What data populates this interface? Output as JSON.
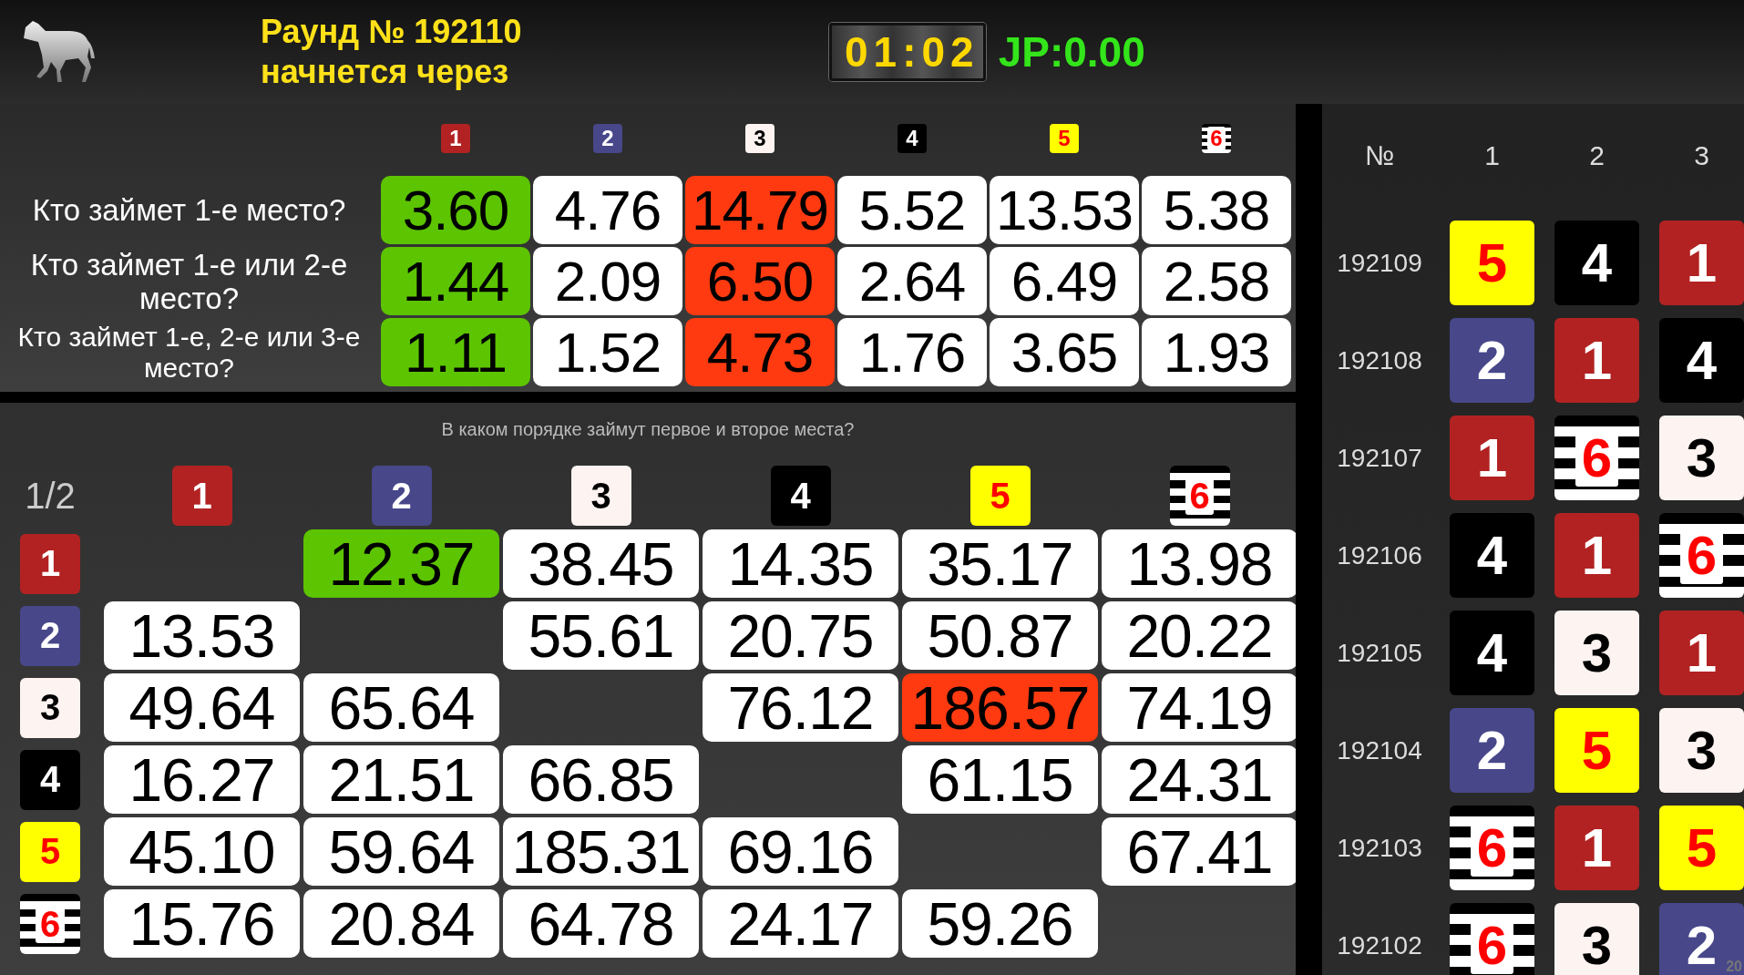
{
  "header": {
    "title_line_1": "Раунд № 192110",
    "title_line_2": "начнется через",
    "timer": "01:02",
    "jackpot": "JP:0.00"
  },
  "win_odds": {
    "columns": [
      {
        "label": "1",
        "color": "#b22222",
        "kind": "solid"
      },
      {
        "label": "2",
        "color": "#47478a",
        "kind": "solid"
      },
      {
        "label": "3",
        "color": "#fdf3f0",
        "kind": "solid"
      },
      {
        "label": "4",
        "color": "#000000",
        "kind": "solid"
      },
      {
        "label": "5",
        "color": "#ffff00",
        "kind": "solid"
      },
      {
        "label": "6",
        "kind": "striped"
      }
    ],
    "rows": [
      {
        "question": "Кто займет 1-е место?",
        "cells": [
          {
            "value": "3.60",
            "color": "#5cc400"
          },
          {
            "value": "4.76",
            "color": "#ffffff"
          },
          {
            "value": "14.79",
            "color": "#ff3a10"
          },
          {
            "value": "5.52",
            "color": "#ffffff"
          },
          {
            "value": "13.53",
            "color": "#ffffff"
          },
          {
            "value": "5.38",
            "color": "#ffffff"
          }
        ]
      },
      {
        "question": "Кто займет 1-е или 2-е место?",
        "cells": [
          {
            "value": "1.44",
            "color": "#5cc400"
          },
          {
            "value": "2.09",
            "color": "#ffffff"
          },
          {
            "value": "6.50",
            "color": "#ff3a10"
          },
          {
            "value": "2.64",
            "color": "#ffffff"
          },
          {
            "value": "6.49",
            "color": "#ffffff"
          },
          {
            "value": "2.58",
            "color": "#ffffff"
          }
        ]
      },
      {
        "question": "Кто займет 1-е, 2-е или 3-е место?",
        "cells": [
          {
            "value": "1.11",
            "color": "#5cc400"
          },
          {
            "value": "1.52",
            "color": "#ffffff"
          },
          {
            "value": "4.73",
            "color": "#ff3a10"
          },
          {
            "value": "1.76",
            "color": "#ffffff"
          },
          {
            "value": "3.65",
            "color": "#ffffff"
          },
          {
            "value": "1.93",
            "color": "#ffffff"
          }
        ]
      }
    ]
  },
  "forecast": {
    "caption": "В каком порядке займут первое и второе места?",
    "corner": "1/2",
    "columns": [
      {
        "label": "1",
        "color": "#b22222",
        "kind": "solid"
      },
      {
        "label": "2",
        "color": "#47478a",
        "kind": "solid"
      },
      {
        "label": "3",
        "color": "#fdf3f0",
        "kind": "solid"
      },
      {
        "label": "4",
        "color": "#000000",
        "kind": "solid"
      },
      {
        "label": "5",
        "color": "#ffff00",
        "kind": "solid"
      },
      {
        "label": "6",
        "kind": "striped"
      }
    ],
    "rows": [
      {
        "badge": {
          "label": "1",
          "color": "#b22222",
          "kind": "solid"
        },
        "cells": [
          {
            "kind": "empty"
          },
          {
            "kind": "odds",
            "value": "12.37",
            "color": "#5cc400"
          },
          {
            "kind": "odds",
            "value": "38.45",
            "color": "#ffffff"
          },
          {
            "kind": "odds",
            "value": "14.35",
            "color": "#ffffff"
          },
          {
            "kind": "odds",
            "value": "35.17",
            "color": "#ffffff"
          },
          {
            "kind": "odds",
            "value": "13.98",
            "color": "#ffffff"
          }
        ]
      },
      {
        "badge": {
          "label": "2",
          "color": "#47478a",
          "kind": "solid"
        },
        "cells": [
          {
            "kind": "odds",
            "value": "13.53",
            "color": "#ffffff"
          },
          {
            "kind": "empty"
          },
          {
            "kind": "odds",
            "value": "55.61",
            "color": "#ffffff"
          },
          {
            "kind": "odds",
            "value": "20.75",
            "color": "#ffffff"
          },
          {
            "kind": "odds",
            "value": "50.87",
            "color": "#ffffff"
          },
          {
            "kind": "odds",
            "value": "20.22",
            "color": "#ffffff"
          }
        ]
      },
      {
        "badge": {
          "label": "3",
          "color": "#fdf3f0",
          "kind": "solid"
        },
        "cells": [
          {
            "kind": "odds",
            "value": "49.64",
            "color": "#ffffff"
          },
          {
            "kind": "odds",
            "value": "65.64",
            "color": "#ffffff"
          },
          {
            "kind": "empty"
          },
          {
            "kind": "odds",
            "value": "76.12",
            "color": "#ffffff"
          },
          {
            "kind": "odds",
            "value": "186.57",
            "color": "#ff3a10"
          },
          {
            "kind": "odds",
            "value": "74.19",
            "color": "#ffffff"
          }
        ]
      },
      {
        "badge": {
          "label": "4",
          "color": "#000000",
          "kind": "solid"
        },
        "cells": [
          {
            "kind": "odds",
            "value": "16.27",
            "color": "#ffffff"
          },
          {
            "kind": "odds",
            "value": "21.51",
            "color": "#ffffff"
          },
          {
            "kind": "odds",
            "value": "66.85",
            "color": "#ffffff"
          },
          {
            "kind": "empty"
          },
          {
            "kind": "odds",
            "value": "61.15",
            "color": "#ffffff"
          },
          {
            "kind": "odds",
            "value": "24.31",
            "color": "#ffffff"
          }
        ]
      },
      {
        "badge": {
          "label": "5",
          "color": "#ffff00",
          "kind": "solid"
        },
        "cells": [
          {
            "kind": "odds",
            "value": "45.10",
            "color": "#ffffff"
          },
          {
            "kind": "odds",
            "value": "59.64",
            "color": "#ffffff"
          },
          {
            "kind": "odds",
            "value": "185.31",
            "color": "#ffffff"
          },
          {
            "kind": "odds",
            "value": "69.16",
            "color": "#ffffff"
          },
          {
            "kind": "empty"
          },
          {
            "kind": "odds",
            "value": "67.41",
            "color": "#ffffff"
          }
        ]
      },
      {
        "badge": {
          "label": "6",
          "kind": "striped"
        },
        "cells": [
          {
            "kind": "odds",
            "value": "15.76",
            "color": "#ffffff"
          },
          {
            "kind": "odds",
            "value": "20.84",
            "color": "#ffffff"
          },
          {
            "kind": "odds",
            "value": "64.78",
            "color": "#ffffff"
          },
          {
            "kind": "odds",
            "value": "24.17",
            "color": "#ffffff"
          },
          {
            "kind": "odds",
            "value": "59.26",
            "color": "#ffffff"
          },
          {
            "kind": "empty"
          }
        ]
      }
    ]
  },
  "history": {
    "columns": [
      "№",
      "1",
      "2",
      "3"
    ],
    "rows": [
      {
        "round": "192109",
        "places": [
          {
            "label": "5",
            "color": "#ffff00",
            "kind": "solid"
          },
          {
            "label": "4",
            "color": "#000000",
            "kind": "solid"
          },
          {
            "label": "1",
            "color": "#b22222",
            "kind": "solid"
          }
        ]
      },
      {
        "round": "192108",
        "places": [
          {
            "label": "2",
            "color": "#47478a",
            "kind": "solid"
          },
          {
            "label": "1",
            "color": "#b22222",
            "kind": "solid"
          },
          {
            "label": "4",
            "color": "#000000",
            "kind": "solid"
          }
        ]
      },
      {
        "round": "192107",
        "places": [
          {
            "label": "1",
            "color": "#b22222",
            "kind": "solid"
          },
          {
            "label": "6",
            "kind": "striped"
          },
          {
            "label": "3",
            "color": "#fdf3f0",
            "kind": "solid"
          }
        ]
      },
      {
        "round": "192106",
        "places": [
          {
            "label": "4",
            "color": "#000000",
            "kind": "solid"
          },
          {
            "label": "1",
            "color": "#b22222",
            "kind": "solid"
          },
          {
            "label": "6",
            "kind": "striped"
          }
        ]
      },
      {
        "round": "192105",
        "places": [
          {
            "label": "4",
            "color": "#000000",
            "kind": "solid"
          },
          {
            "label": "3",
            "color": "#fdf3f0",
            "kind": "solid"
          },
          {
            "label": "1",
            "color": "#b22222",
            "kind": "solid"
          }
        ]
      },
      {
        "round": "192104",
        "places": [
          {
            "label": "2",
            "color": "#47478a",
            "kind": "solid"
          },
          {
            "label": "5",
            "color": "#ffff00",
            "kind": "solid"
          },
          {
            "label": "3",
            "color": "#fdf3f0",
            "kind": "solid"
          }
        ]
      },
      {
        "round": "192103",
        "places": [
          {
            "label": "6",
            "kind": "striped"
          },
          {
            "label": "1",
            "color": "#b22222",
            "kind": "solid"
          },
          {
            "label": "5",
            "color": "#ffff00",
            "kind": "solid"
          }
        ]
      },
      {
        "round": "192102",
        "places": [
          {
            "label": "6",
            "kind": "striped"
          },
          {
            "label": "3",
            "color": "#fdf3f0",
            "kind": "solid"
          },
          {
            "label": "2",
            "color": "#47478a",
            "kind": "solid"
          }
        ]
      }
    ],
    "corner_number": "20"
  }
}
